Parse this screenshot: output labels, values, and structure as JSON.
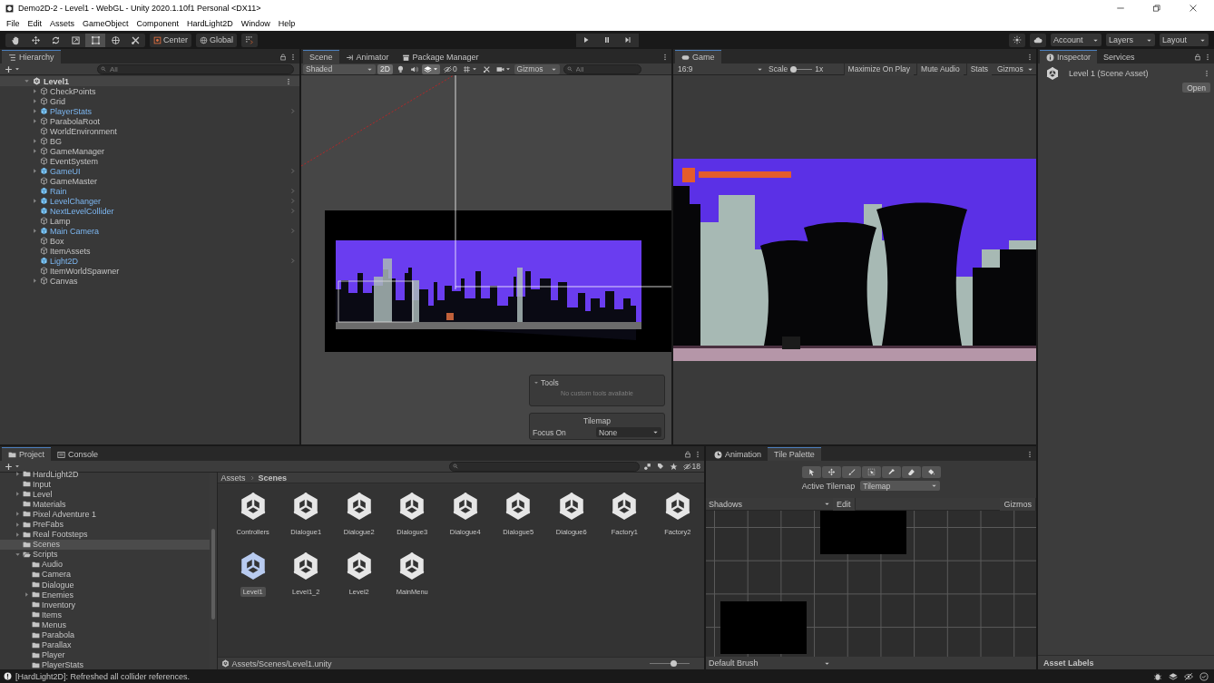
{
  "window": {
    "title": "Demo2D-2 - Level1 - WebGL - Unity 2020.1.10f1 Personal <DX11>"
  },
  "menu": [
    "File",
    "Edit",
    "Assets",
    "GameObject",
    "Component",
    "HardLight2D",
    "Window",
    "Help"
  ],
  "toolbar": {
    "tools": [
      {
        "kind": "hand",
        "selected": false
      },
      {
        "kind": "move",
        "selected": false
      },
      {
        "kind": "rotate",
        "selected": false
      },
      {
        "kind": "scale",
        "selected": false
      },
      {
        "kind": "rect",
        "selected": true
      },
      {
        "kind": "transform",
        "selected": false
      },
      {
        "kind": "custom",
        "selected": false
      }
    ],
    "pivot": "Center",
    "space": "Global",
    "account": "Account",
    "layers": "Layers",
    "layout": "Layout"
  },
  "hierarchy": {
    "tabs": [
      {
        "label": "Hierarchy",
        "kind": "hierarchy",
        "selected": true
      }
    ],
    "search_placeholder": "All",
    "scene": "Level1",
    "items": [
      {
        "name": "CheckPoints",
        "prefab": false,
        "expandable": true
      },
      {
        "name": "Grid",
        "prefab": false,
        "expandable": true
      },
      {
        "name": "PlayerStats",
        "prefab": true,
        "expandable": true
      },
      {
        "name": "ParabolaRoot",
        "prefab": false,
        "expandable": true
      },
      {
        "name": "WorldEnvironment",
        "prefab": false,
        "expandable": false
      },
      {
        "name": "BG",
        "prefab": false,
        "expandable": true
      },
      {
        "name": "GameManager",
        "prefab": false,
        "expandable": true
      },
      {
        "name": "EventSystem",
        "prefab": false,
        "expandable": false
      },
      {
        "name": "GameUI",
        "prefab": true,
        "expandable": true
      },
      {
        "name": "GameMaster",
        "prefab": false,
        "expandable": false
      },
      {
        "name": "Rain",
        "prefab": true,
        "expandable": false
      },
      {
        "name": "LevelChanger",
        "prefab": true,
        "expandable": true
      },
      {
        "name": "NextLevelCollider",
        "prefab": true,
        "expandable": false
      },
      {
        "name": "Lamp",
        "prefab": false,
        "expandable": false
      },
      {
        "name": "Main Camera",
        "prefab": true,
        "expandable": true
      },
      {
        "name": "Box",
        "prefab": false,
        "expandable": false
      },
      {
        "name": "ItemAssets",
        "prefab": false,
        "expandable": false
      },
      {
        "name": "Light2D",
        "prefab": true,
        "expandable": false
      },
      {
        "name": "ItemWorldSpawner",
        "prefab": false,
        "expandable": false
      },
      {
        "name": "Canvas",
        "prefab": false,
        "expandable": true
      }
    ]
  },
  "scene_view": {
    "tabs": [
      {
        "label": "Scene",
        "kind": "scene",
        "selected": true
      },
      {
        "label": "Animator",
        "kind": "animator",
        "selected": false
      },
      {
        "label": "Package Manager",
        "kind": "package",
        "selected": false
      }
    ],
    "shading": "Shaded",
    "mode_2d": {
      "label": "2D",
      "on": true
    },
    "toggles": [
      {
        "kind": "lighting",
        "on": false
      },
      {
        "kind": "audio",
        "on": false
      },
      {
        "kind": "effects",
        "on": true
      }
    ],
    "grid_toggles": [
      {
        "kind": "grid",
        "on": false
      },
      {
        "kind": "tools",
        "on": false
      },
      {
        "kind": "camera",
        "on": false
      }
    ],
    "hidden_count": "0",
    "gizmos": "Gizmos",
    "search_placeholder": "All",
    "tools_overlay": {
      "title": "Tools",
      "message": "No custom tools available"
    },
    "tilemap_overlay": {
      "title": "Tilemap",
      "focus_label": "Focus On",
      "focus_value": "None"
    }
  },
  "game_view": {
    "tabs": [
      {
        "label": "Game",
        "kind": "game",
        "selected": true
      }
    ],
    "aspect": "16:9",
    "scale_label": "Scale",
    "scale_slider": {
      "level": 0.1
    },
    "scale_value": "1x",
    "toggles": [
      {
        "label": "Maximize On Play",
        "on": false
      },
      {
        "label": "Mute Audio",
        "on": false
      },
      {
        "label": "Stats",
        "on": false
      }
    ],
    "gizmos": "Gizmos"
  },
  "inspector": {
    "tabs": [
      {
        "label": "Inspector",
        "kind": "inspector",
        "selected": true
      },
      {
        "label": "Services",
        "kind": "plain",
        "selected": false
      }
    ],
    "asset_title": "Level 1 (Scene Asset)",
    "open_button": "Open",
    "asset_labels": "Asset Labels"
  },
  "project": {
    "tabs": [
      {
        "label": "Project",
        "kind": "project",
        "selected": true
      },
      {
        "label": "Console",
        "kind": "console",
        "selected": false
      }
    ],
    "hidden_count": "18",
    "folders": [
      {
        "name": "HardLight2D",
        "expandable": true,
        "expanded": false,
        "selected": false
      },
      {
        "name": "Input",
        "expandable": false,
        "expanded": false,
        "selected": false
      },
      {
        "name": "Level",
        "expandable": true,
        "expanded": false,
        "selected": false
      },
      {
        "name": "Materials",
        "expandable": false,
        "expanded": false,
        "selected": false
      },
      {
        "name": "Pixel Adventure 1",
        "expandable": true,
        "expanded": false,
        "selected": false
      },
      {
        "name": "PreFabs",
        "expandable": true,
        "expanded": false,
        "selected": false
      },
      {
        "name": "Real Footsteps",
        "expandable": true,
        "expanded": false,
        "selected": false
      },
      {
        "name": "Scenes",
        "expandable": false,
        "expanded": false,
        "selected": true
      },
      {
        "name": "Scripts",
        "expandable": true,
        "expanded": true,
        "selected": false,
        "children": [
          {
            "name": "Audio",
            "expandable": false,
            "expanded": false,
            "selected": false
          },
          {
            "name": "Camera",
            "expandable": false,
            "expanded": false,
            "selected": false
          },
          {
            "name": "Dialogue",
            "expandable": false,
            "expanded": false,
            "selected": false
          },
          {
            "name": "Enemies",
            "expandable": true,
            "expanded": false,
            "selected": false
          },
          {
            "name": "Inventory",
            "expandable": false,
            "expanded": false,
            "selected": false
          },
          {
            "name": "Items",
            "expandable": false,
            "expanded": false,
            "selected": false
          },
          {
            "name": "Menus",
            "expandable": false,
            "expanded": false,
            "selected": false
          },
          {
            "name": "Parabola",
            "expandable": false,
            "expanded": false,
            "selected": false
          },
          {
            "name": "Parallax",
            "expandable": false,
            "expanded": false,
            "selected": false
          },
          {
            "name": "Player",
            "expandable": false,
            "expanded": false,
            "selected": false
          },
          {
            "name": "PlayerStats",
            "expandable": false,
            "expanded": false,
            "selected": false
          }
        ]
      }
    ],
    "breadcrumb": [
      "Assets",
      "Scenes"
    ],
    "assets": [
      {
        "name": "Controllers",
        "selected": false
      },
      {
        "name": "Dialogue1",
        "selected": false
      },
      {
        "name": "Dialogue2",
        "selected": false
      },
      {
        "name": "Dialogue3",
        "selected": false
      },
      {
        "name": "Dialogue4",
        "selected": false
      },
      {
        "name": "Dialogue5",
        "selected": false
      },
      {
        "name": "Dialogue6",
        "selected": false
      },
      {
        "name": "Factory1",
        "selected": false
      },
      {
        "name": "Factory2",
        "selected": false
      },
      {
        "name": "Level1",
        "selected": true
      },
      {
        "name": "Level1_2",
        "selected": false
      },
      {
        "name": "Level2",
        "selected": false
      },
      {
        "name": "MainMenu",
        "selected": false
      }
    ],
    "path": "Assets/Scenes/Level1.unity",
    "size_slider": {
      "level": 0.6
    }
  },
  "tile_palette": {
    "tabs": [
      {
        "label": "Animation",
        "kind": "animation",
        "selected": false
      },
      {
        "label": "Tile Palette",
        "kind": "plain",
        "selected": true
      }
    ],
    "tools": [
      {
        "kind": "select",
        "selected": false
      },
      {
        "kind": "move",
        "selected": false
      },
      {
        "kind": "paint",
        "selected": false
      },
      {
        "kind": "box",
        "selected": false
      },
      {
        "kind": "picker",
        "selected": false
      },
      {
        "kind": "eraser",
        "selected": false
      },
      {
        "kind": "fill",
        "selected": false
      }
    ],
    "active_tilemap_label": "Active Tilemap",
    "active_tilemap": "Tilemap",
    "palette": "Shadows",
    "edit": "Edit",
    "gizmos": "Gizmos",
    "brush": "Default Brush"
  },
  "status_bar": {
    "message": "[HardLight2D]: Refreshed all collider references."
  }
}
